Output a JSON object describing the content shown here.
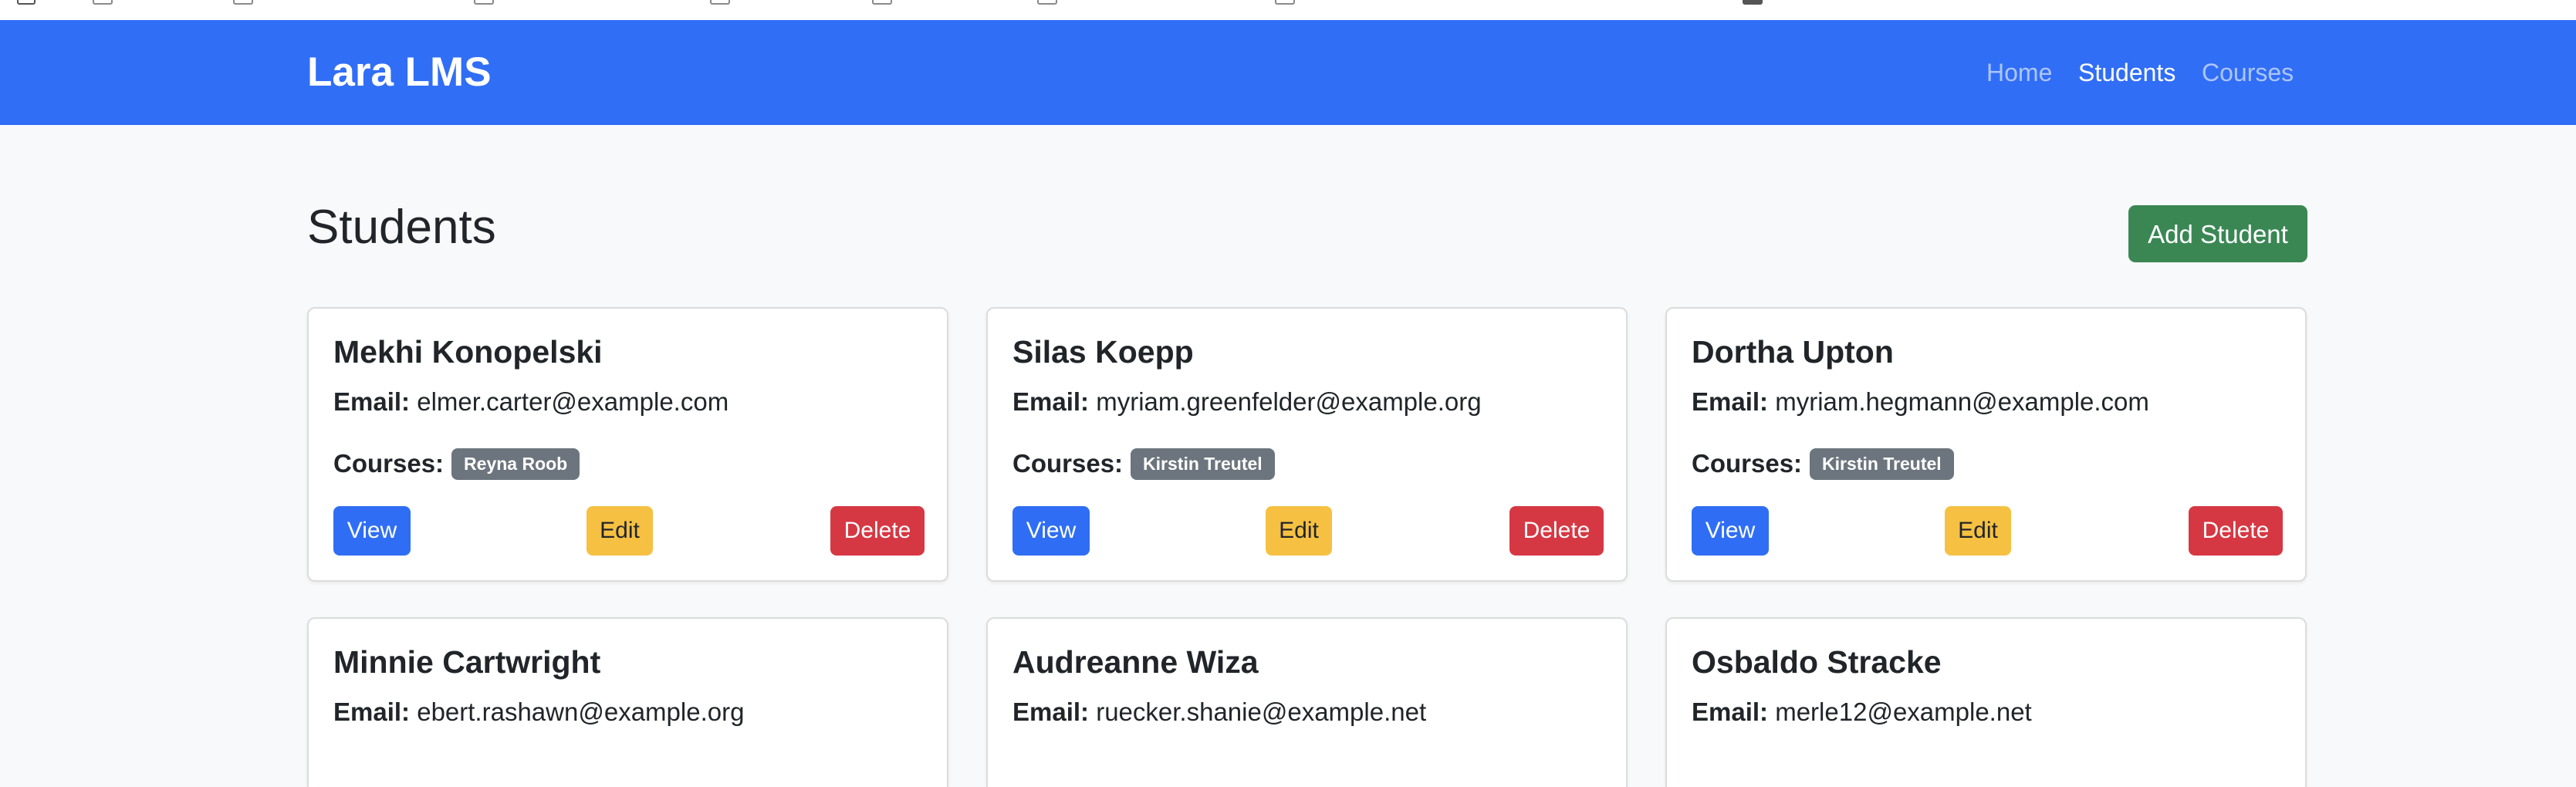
{
  "navbar": {
    "brand": "Lara LMS",
    "links": [
      {
        "label": "Home",
        "active": false
      },
      {
        "label": "Students",
        "active": true
      },
      {
        "label": "Courses",
        "active": false
      }
    ]
  },
  "page": {
    "title": "Students",
    "add_button": "Add Student"
  },
  "labels": {
    "email": "Email:",
    "courses": "Courses:",
    "view": "View",
    "edit": "Edit",
    "delete": "Delete"
  },
  "students": [
    {
      "name": "Mekhi Konopelski",
      "email": "elmer.carter@example.com",
      "courses": [
        "Reyna Roob"
      ]
    },
    {
      "name": "Silas Koepp",
      "email": "myriam.greenfelder@example.org",
      "courses": [
        "Kirstin Treutel"
      ]
    },
    {
      "name": "Dortha Upton",
      "email": "myriam.hegmann@example.com",
      "courses": [
        "Kirstin Treutel"
      ]
    },
    {
      "name": "Minnie Cartwright",
      "email": "ebert.rashawn@example.org"
    },
    {
      "name": "Audreanne Wiza",
      "email": "ruecker.shanie@example.net"
    },
    {
      "name": "Osbaldo Stracke",
      "email": "merle12@example.net"
    }
  ],
  "colors": {
    "navbar": "#316ef6",
    "primary": "#2f6ef4",
    "success": "#3a8754",
    "warning": "#f6c142",
    "danger": "#d63843",
    "badge": "#6c757d",
    "background": "#f8f9fa"
  }
}
